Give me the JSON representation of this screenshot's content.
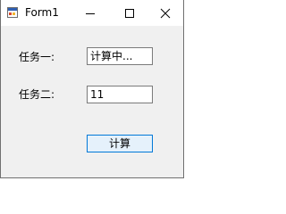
{
  "window": {
    "title": "Form1",
    "controls": {
      "minimize_icon": "minimize-icon",
      "maximize_icon": "maximize-icon",
      "close_icon": "close-icon"
    }
  },
  "form": {
    "task1_label": "任务一:",
    "task1_value": "计算中...",
    "task2_label": "任务二:",
    "task2_value": "11",
    "compute_button": "计算"
  },
  "colors": {
    "button_border": "#0078d7",
    "button_fill": "#e5f1fb",
    "client_background": "#f0f0f0"
  }
}
